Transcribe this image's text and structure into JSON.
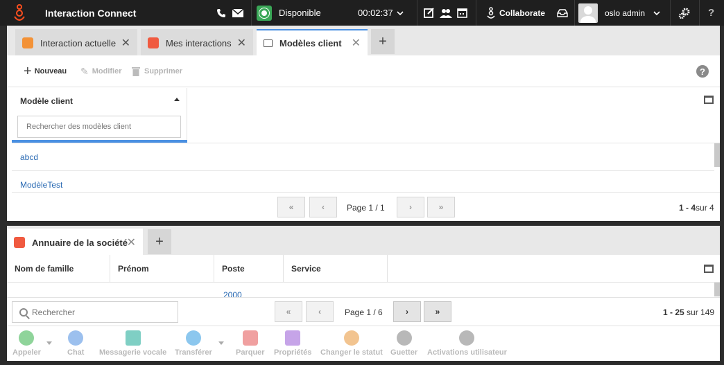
{
  "topbar": {
    "app_title": "Interaction Connect",
    "status": "Disponible",
    "timer": "00:02:37",
    "collaborate": "Collaborate",
    "user": "oslo admin",
    "help": "?"
  },
  "tabs": [
    {
      "label": "Interaction actuelle",
      "icon": "chat-bubble-icon",
      "color": "#f39237"
    },
    {
      "label": "Mes interactions",
      "icon": "interactions-icon",
      "color": "#f05a40"
    },
    {
      "label": "Modèles client",
      "icon": "template-icon",
      "color": "#555555"
    }
  ],
  "toolbar": {
    "new": "Nouveau",
    "edit": "Modifier",
    "delete": "Supprimer"
  },
  "templates": {
    "column": "Modèle client",
    "search_placeholder": "Rechercher des modèles client",
    "rows": [
      "abcd",
      "ModèleTest"
    ],
    "page": "Page 1 / 1",
    "range": "1 - 4",
    "range_total": "sur 4"
  },
  "directory": {
    "tab": "Annuaire de la société",
    "columns": [
      "Nom de famille",
      "Prénom",
      "Poste",
      "Service"
    ],
    "partial_value": "2000",
    "search_placeholder": "Rechercher",
    "page": "Page 1 / 6",
    "range": "1 - 25",
    "range_total": "sur 149"
  },
  "actions": [
    {
      "label": "Appeler",
      "color": "#8fd49a"
    },
    {
      "label": "Chat",
      "color": "#9cc0ee"
    },
    {
      "label": "Messagerie vocale",
      "color": "#7fcfc4"
    },
    {
      "label": "Transférer",
      "color": "#8cc7ee"
    },
    {
      "label": "Parquer",
      "color": "#f0a0a0"
    },
    {
      "label": "Propriétés",
      "color": "#c6a4e8"
    },
    {
      "label": "Changer le statut",
      "color": "#f2c490"
    },
    {
      "label": "Guetter",
      "color": "#b8b8b8"
    },
    {
      "label": "Activations utilisateur",
      "color": "#b8b8b8"
    }
  ],
  "colors": {
    "accent": "#4a90e2",
    "link": "#2a6ab3",
    "topbar": "#1f1f1f",
    "genesys": "#ff4f1f"
  }
}
